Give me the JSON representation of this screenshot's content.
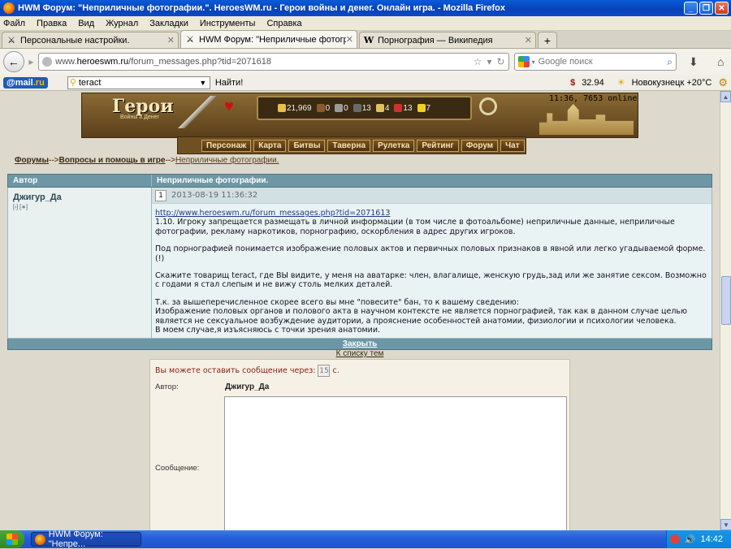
{
  "window": {
    "title": "HWM Форум: \"Неприличные фотографии.\". HeroesWM.ru - Герои войны и денег. Онлайн игра. - Mozilla Firefox",
    "min_label": "_",
    "max_label": "❐",
    "close_label": "✕"
  },
  "menu": [
    "Файл",
    "Правка",
    "Вид",
    "Журнал",
    "Закладки",
    "Инструменты",
    "Справка"
  ],
  "tabs": [
    {
      "label": "Персональные настройки.",
      "icon": "⚔"
    },
    {
      "label": "HWM Форум: \"Неприличные фотограф...",
      "icon": "⚔"
    },
    {
      "label": "Порнография — Википедия",
      "icon": "W"
    }
  ],
  "newtab_label": "+",
  "url": {
    "prefix": "www.",
    "host": "heroeswm.ru",
    "path": "/forum_messages.php?tid=2071618"
  },
  "search": {
    "placeholder": "Google поиск"
  },
  "mailbar": {
    "logo_at": "@mail",
    "logo_ru": ".ru",
    "search_value": "teract",
    "find_label": "Найти!",
    "currency": "32.94",
    "weather": "Новокузнецк +20°C"
  },
  "game": {
    "logo": "Герои",
    "logo_sub": "Войны и Денег",
    "online": "11:36, 7653 online",
    "resources": [
      {
        "value": "21,969",
        "color": "#e8c04a",
        "icon": "gold-icon"
      },
      {
        "value": "0",
        "color": "#8a5a2a",
        "icon": "wood-icon"
      },
      {
        "value": "0",
        "color": "#9a9a9a",
        "icon": "ore-icon"
      },
      {
        "value": "13",
        "color": "#6a6a6a",
        "icon": "mercury-icon"
      },
      {
        "value": "4",
        "color": "#e0c060",
        "icon": "sulfur-icon"
      },
      {
        "value": "13",
        "color": "#d03030",
        "icon": "crystal-icon"
      },
      {
        "value": "7",
        "color": "#f0d020",
        "icon": "gems-icon"
      }
    ],
    "nav": [
      "Персонаж",
      "Карта",
      "Битвы",
      "Таверна",
      "Рулетка",
      "Рейтинг",
      "Форум",
      "Чат"
    ]
  },
  "crumbs": {
    "c1": "Форумы",
    "c2": "Вопросы и помощь в игре",
    "c3": "Неприличные фотографии.",
    "sep": "-->"
  },
  "forum": {
    "col_author": "Автор",
    "col_topic": "Неприличные фотографии.",
    "post": {
      "author": "Джигур_Да",
      "author_small": "[›] [∗]",
      "number": "1",
      "date": "2013-08-19 11:36:32",
      "link": "http://www.heroeswm.ru/forum_messages.php?tid=2071613",
      "p1": "1.10. Игроку запрещается размещать в личной информации (в том числе в фотоальбоме) неприличные данные, неприличные фотографии, рекламу наркотиков, порнографию, оскорбления в адрес других игроков.",
      "p2": "Под порнографией понимается изображение половых актов и первичных половых признаков в явной или легко угадываемой форме.(!)",
      "p3": "Скажите товарищ teract, где ВЫ видите, у меня на аватарке: член, влагалище, женскую грудь,зад или же занятие сексом. Возможно с годами я стал слепым и не вижу столь мелких деталей.",
      "p4a": "Т.к. за вышеперечисленное скорее всего вы мне \"повесите\" бан, то к вашему сведению:",
      "p4b": "Изображение половых органов и полового акта в научном контексте не является порнографией, так как в данном случае целью является не сексуальное возбуждение аудитории, а прояснение особенностей анатомии, физиологии и психологии человека.",
      "p4c": "В моем случае,я изъясняюсь с точки зрения анатомии."
    },
    "close_link": "Закрыть",
    "to_list": "К списку тем"
  },
  "reply": {
    "wait_prefix": "Вы можете оставить сообщение через:",
    "wait_value": "15",
    "wait_suffix": "с.",
    "author_label": "Автор:",
    "author_value": "Джигур_Да",
    "message_label": "Сообщение:"
  },
  "taskbar": {
    "item": "HWM Форум: \"Непре...",
    "clock": "14:42"
  }
}
